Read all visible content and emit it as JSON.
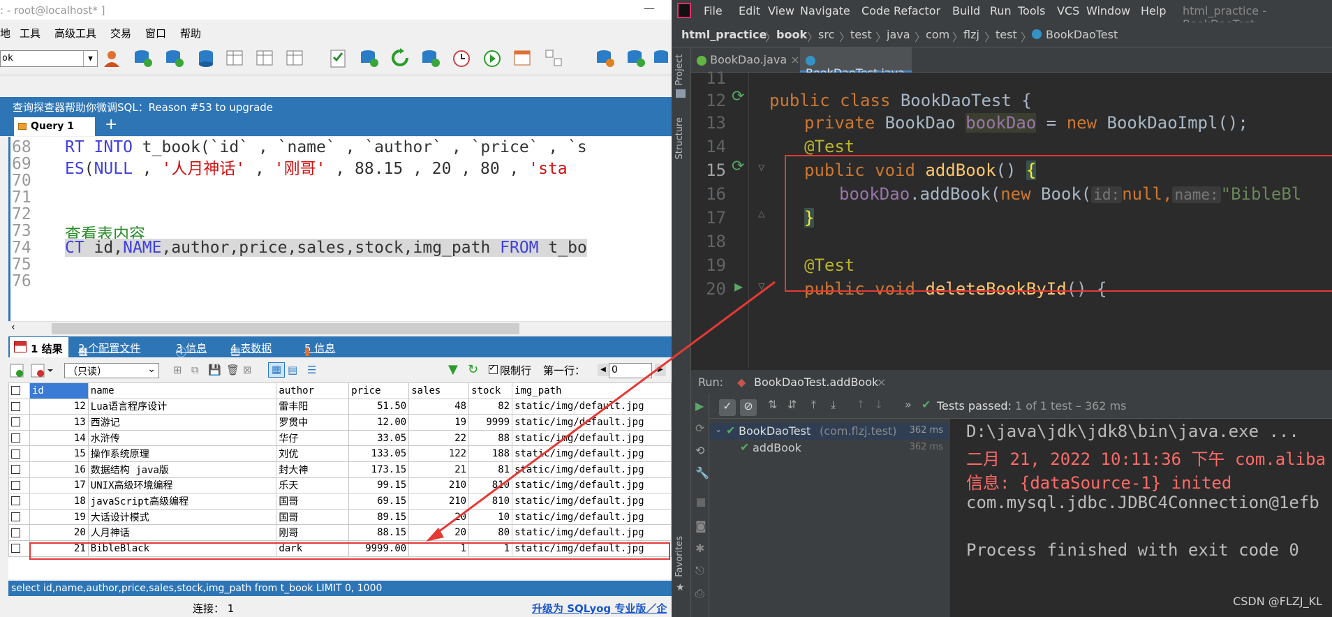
{
  "sqlyog": {
    "title": ": - root@localhost* ]",
    "close": "—",
    "menu": [
      "地",
      "工具",
      "高级工具",
      "交易",
      "窗口",
      "帮助"
    ],
    "db_combo": "ok",
    "notice": "查询探查器帮助你微调SQL：Reason #53 to upgrade",
    "query_tab": "Query 1",
    "plus": "+",
    "editor": [
      {
        "n": "68",
        "code": "RT INTO t_book(`id` , `name` , `author` , `price` , `s"
      },
      {
        "n": "69",
        "code": "ES(NULL , '人月神话' , '刚哥' , 88.15 , 20 , 80 , 'sta"
      },
      {
        "n": "70",
        "code": ""
      },
      {
        "n": "71",
        "code": ""
      },
      {
        "n": "72",
        "code": ""
      },
      {
        "n": "73",
        "code": "查看表内容"
      },
      {
        "n": "74",
        "code": "CT id,NAME,author,price,sales,stock,img_path FROM t_bo"
      },
      {
        "n": "75",
        "code": ""
      },
      {
        "n": "76",
        "code": ""
      }
    ],
    "result_tabs": {
      "t1": "1 结果",
      "t2": "2 个配置文件",
      "t3": "3 信息",
      "t4": "4 表数据",
      "t5": "5 信息"
    },
    "readonly": "（只读）",
    "limit_rows": "限制行",
    "first_row": "第一行：",
    "first_row_val": "0",
    "columns": [
      "id",
      "name",
      "author",
      "price",
      "sales",
      "stock",
      "img_path"
    ],
    "rows": [
      [
        "12",
        "Lua语言程序设计",
        "雷丰阳",
        "51.50",
        "48",
        "82",
        "static/img/default.jpg"
      ],
      [
        "13",
        "西游记",
        "罗贯中",
        "12.00",
        "19",
        "9999",
        "static/img/default.jpg"
      ],
      [
        "14",
        "水浒传",
        "华仔",
        "33.05",
        "22",
        "88",
        "static/img/default.jpg"
      ],
      [
        "15",
        "操作系统原理",
        "刘优",
        "133.05",
        "122",
        "188",
        "static/img/default.jpg"
      ],
      [
        "16",
        "数据结构 java版",
        "封大神",
        "173.15",
        "21",
        "81",
        "static/img/default.jpg"
      ],
      [
        "17",
        "UNIX高级环境编程",
        "乐天",
        "99.15",
        "210",
        "810",
        "static/img/default.jpg"
      ],
      [
        "18",
        "javaScript高级编程",
        "国哥",
        "69.15",
        "210",
        "810",
        "static/img/default.jpg"
      ],
      [
        "19",
        "大话设计模式",
        "国哥",
        "89.15",
        "20",
        "10",
        "static/img/default.jpg"
      ],
      [
        "20",
        "人月神话",
        "刚哥",
        "88.15",
        "20",
        "80",
        "static/img/default.jpg"
      ],
      [
        "21",
        "BibleBlack",
        "dark",
        "9999.00",
        "1",
        "1",
        "static/img/default.jpg"
      ]
    ],
    "status_sql": "select id,name,author,price,sales,stock,img_path from t_book LIMIT 0, 1000",
    "connection": "连接： 1",
    "upgrade": "升级为 SQLyog 专业版／企"
  },
  "idea": {
    "menu": [
      "File",
      "Edit",
      "View",
      "Navigate",
      "Code",
      "Refactor",
      "Build",
      "Run",
      "Tools",
      "VCS",
      "Window",
      "Help"
    ],
    "window_title": "html_practice - BookDaoTest",
    "breadcrumb": [
      "html_practice",
      "book",
      "src",
      "test",
      "java",
      "com",
      "flzj",
      "test",
      "BookDaoTest"
    ],
    "file_tabs": [
      "BookDao.java",
      "BookDaoTest.java"
    ],
    "side_project": "Project",
    "side_structure": "Structure",
    "side_favorites": "Favorites",
    "lines": [
      "11",
      "12",
      "13",
      "14",
      "15",
      "16",
      "17",
      "18",
      "19",
      "20"
    ],
    "code": {
      "l12_a": "public class ",
      "l12_b": "BookDaoTest {",
      "l13_a": "private ",
      "l13_b": "BookDao ",
      "l13_c": "bookDao",
      "l13_d": " = ",
      "l13_e": "new ",
      "l13_f": "BookDaoImpl();",
      "l14": "@Test",
      "l15_a": "public void ",
      "l15_b": "addBook",
      "l15_c": "() ",
      "l15_d": "{",
      "l16_a": "bookDao",
      "l16_b": ".addBook(",
      "l16_c": "new ",
      "l16_d": "Book(",
      "l16_h1": "id:",
      "l16_e": "null,",
      "l16_h2": "name:",
      "l16_f": "\"BibleBl",
      "l17": "}",
      "l19": "@Test",
      "l20_a": "public void ",
      "l20_b": "deleteBookById",
      "l20_c": "() {"
    },
    "run_label": "Run:",
    "run_tab": "BookDaoTest.addBook",
    "tests_passed": "Tests passed:",
    "tests_detail": "1 of 1 test – 362 ms",
    "tree": [
      {
        "name": "BookDaoTest",
        "pkg": "(com.flzj.test)",
        "time": "362 ms"
      },
      {
        "name": "addBook",
        "pkg": "",
        "time": "362 ms"
      }
    ],
    "console": [
      "D:\\java\\jdk\\jdk8\\bin\\java.exe ...",
      "二月 21, 2022 10:11:36 下午 com.aliba",
      "信息: {dataSource-1} inited",
      "com.mysql.jdbc.JDBC4Connection@1efb",
      "",
      "Process finished with exit code 0"
    ],
    "watermark": "CSDN @FLZJ_KL"
  }
}
